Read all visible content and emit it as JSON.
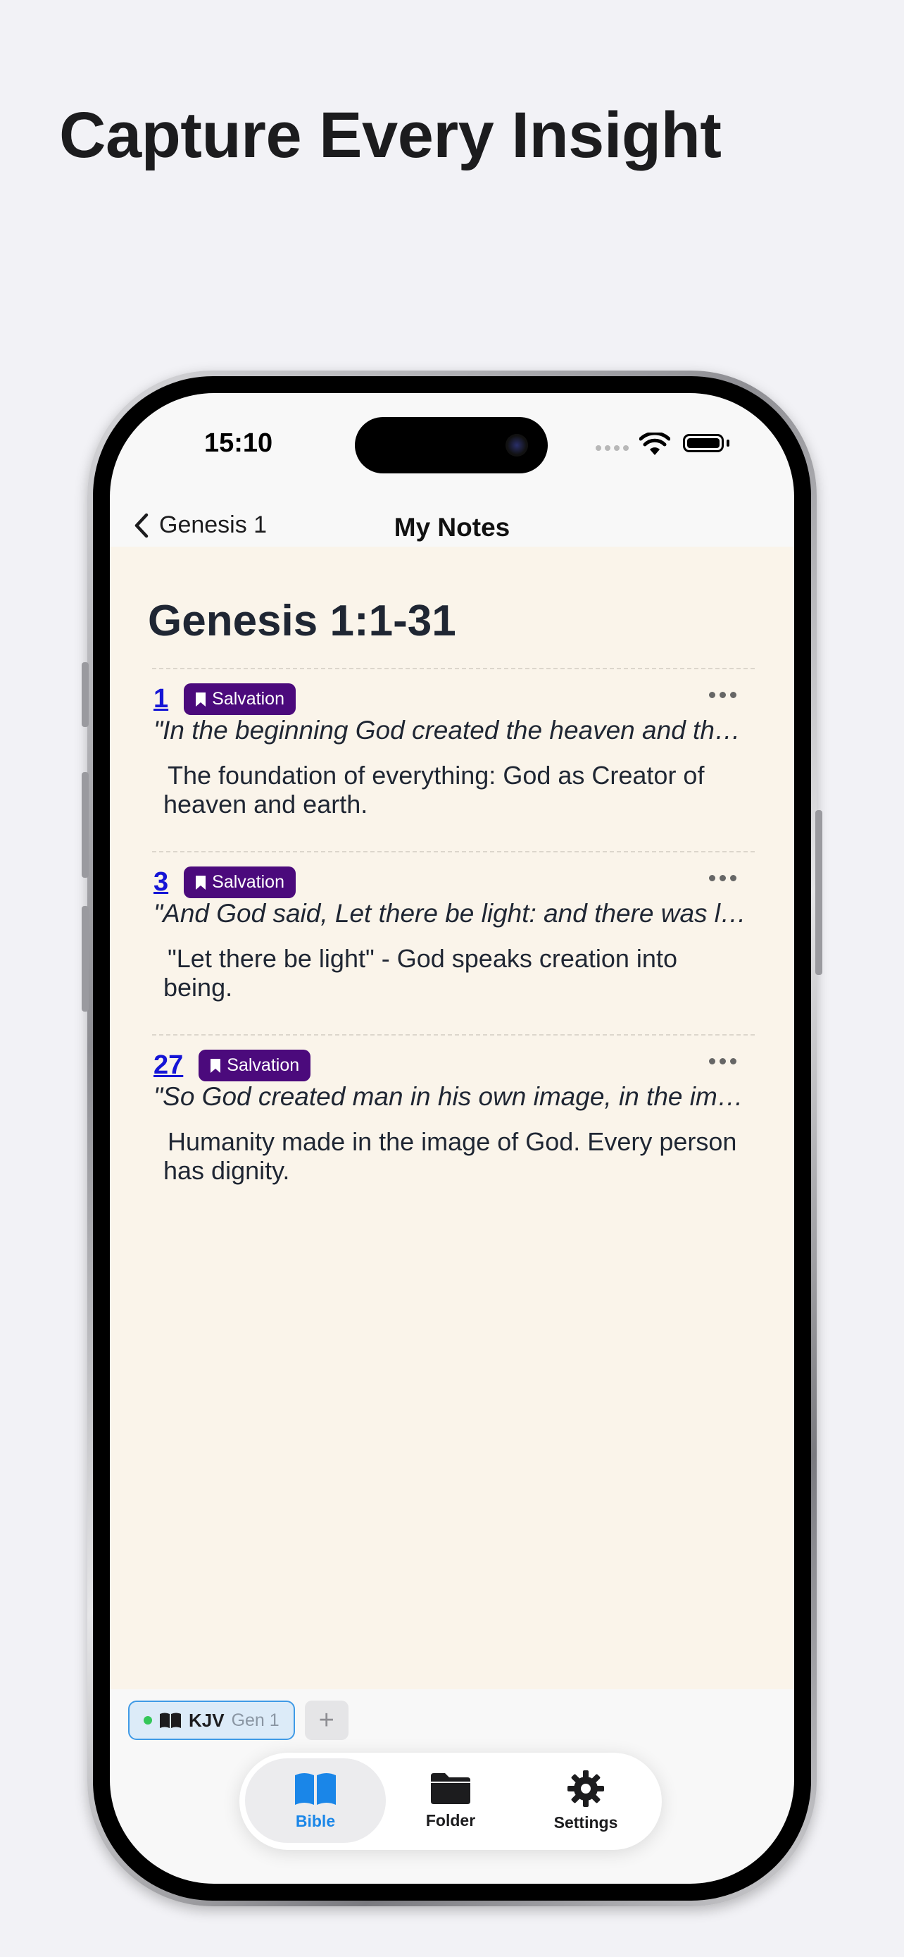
{
  "headline": "Capture Every Insight",
  "status_bar": {
    "time": "15:10"
  },
  "nav": {
    "back_label": "Genesis 1",
    "title": "My Notes"
  },
  "section_title": "Genesis 1:1-31",
  "notes": [
    {
      "verse": "1",
      "tag": "Salvation",
      "verse_text": "\"In the beginning God created the heaven and the earth.\"",
      "note": "The foundation of everything: God as Creator of heaven and earth."
    },
    {
      "verse": "3",
      "tag": "Salvation",
      "verse_text": "\"And God said, Let there be light: and there was light.\"",
      "note": "\"Let there be light\" - God speaks creation into being."
    },
    {
      "verse": "27",
      "tag": "Salvation",
      "verse_text": "\"So God created man in his own image, in the image of God created he him.\"",
      "note": "Humanity made in the image of God. Every person has dignity."
    }
  ],
  "reading_tab": {
    "version": "KJV",
    "reference": "Gen 1"
  },
  "add_tab_symbol": "+",
  "tab_bar": [
    {
      "label": "Bible",
      "icon": "open-book-icon",
      "active": true
    },
    {
      "label": "Folder",
      "icon": "folder-icon",
      "active": false
    },
    {
      "label": "Settings",
      "icon": "gear-icon",
      "active": false
    }
  ],
  "colors": {
    "page_background": "#f2f2f6",
    "content_background": "#faf4ea",
    "tag_background": "#4b0a7c",
    "verse_link": "#1515d6",
    "accent": "#1a86e8",
    "status_dot": "#34c759"
  }
}
